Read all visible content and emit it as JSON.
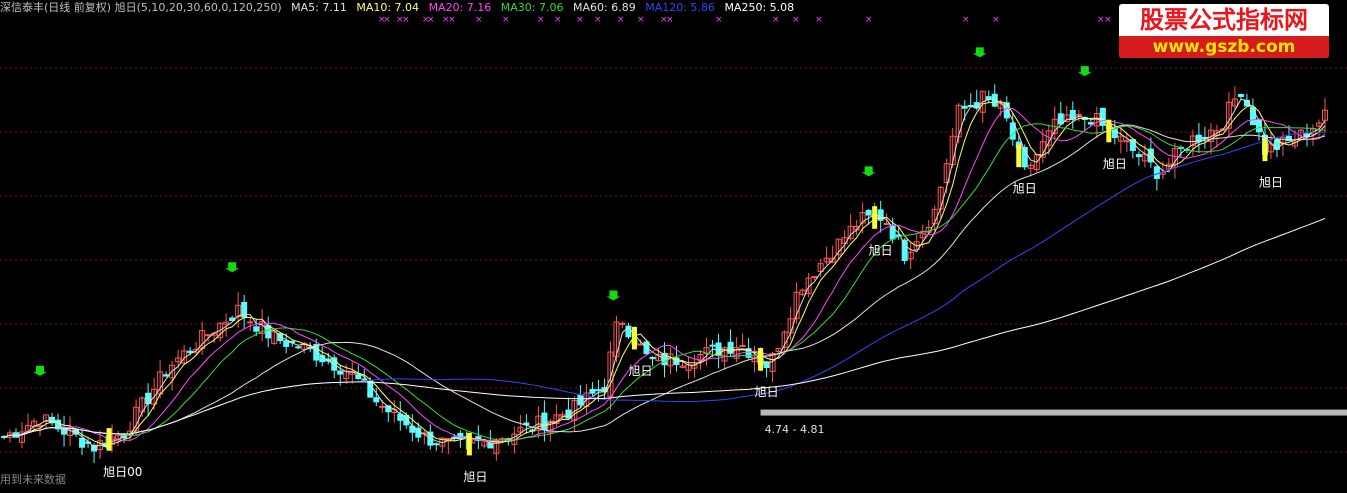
{
  "header": {
    "name": "深信泰丰(日线 前复权) 旭日(5,10,20,30,60,0,120,250)",
    "ma": [
      {
        "label": "MA5: 7.11",
        "color": "#e0e0e0"
      },
      {
        "label": "MA10: 7.04",
        "color": "#ffff66"
      },
      {
        "label": "MA20: 7.16",
        "color": "#ff44ff"
      },
      {
        "label": "MA30: 7.06",
        "color": "#33dd33"
      },
      {
        "label": "MA60: 6.89",
        "color": "#e0e0e0"
      },
      {
        "label": "MA120: 5.86",
        "color": "#3344ff"
      },
      {
        "label": "MA250: 5.08",
        "color": "#ffffff"
      }
    ]
  },
  "watermark": {
    "title": "股票公式指标网",
    "url": "www.gszb.com"
  },
  "footer_note": "用到未来数据",
  "colors": {
    "up": "#ff5555",
    "down": "#54ffff",
    "signal": "#ffff33",
    "arrow": "#11dd11",
    "grid": "#7a1515"
  },
  "chart_data": {
    "type": "candlestick",
    "n": 400,
    "ylim": [
      4.2,
      9.0
    ],
    "price_zone": {
      "label": "4.74 - 4.81",
      "low": 4.74,
      "high": 4.81
    },
    "signal_label": "旭日",
    "signal_days": [
      35,
      155,
      210,
      252,
      290,
      338,
      368,
      420
    ],
    "signal_texts": [
      {
        "day": 35,
        "text": "旭日00"
      },
      {
        "day": 155,
        "text": "旭日"
      },
      {
        "day": 210,
        "text": "旭日"
      },
      {
        "day": 252,
        "text": "旭日"
      },
      {
        "day": 290,
        "text": "旭日"
      },
      {
        "day": 338,
        "text": "旭日"
      },
      {
        "day": 368,
        "text": "旭日"
      },
      {
        "day": 420,
        "text": "旭日"
      }
    ],
    "peak_arrows": [
      12,
      76,
      203,
      288,
      325,
      360,
      410
    ],
    "close_path": [
      [
        0,
        4.55
      ],
      [
        12,
        4.75
      ],
      [
        20,
        4.62
      ],
      [
        30,
        4.45
      ],
      [
        40,
        4.6
      ],
      [
        55,
        5.3
      ],
      [
        70,
        5.7
      ],
      [
        78,
        5.9
      ],
      [
        90,
        5.6
      ],
      [
        100,
        5.5
      ],
      [
        115,
        5.25
      ],
      [
        125,
        4.9
      ],
      [
        140,
        4.55
      ],
      [
        150,
        4.45
      ],
      [
        160,
        4.5
      ],
      [
        175,
        4.65
      ],
      [
        190,
        4.85
      ],
      [
        200,
        5.1
      ],
      [
        205,
        5.85
      ],
      [
        215,
        5.35
      ],
      [
        230,
        5.4
      ],
      [
        245,
        5.55
      ],
      [
        255,
        5.3
      ],
      [
        265,
        6.15
      ],
      [
        275,
        6.5
      ],
      [
        285,
        6.85
      ],
      [
        293,
        6.9
      ],
      [
        300,
        6.5
      ],
      [
        310,
        6.95
      ],
      [
        318,
        8.0
      ],
      [
        326,
        8.15
      ],
      [
        333,
        8.0
      ],
      [
        340,
        7.35
      ],
      [
        350,
        7.85
      ],
      [
        362,
        7.95
      ],
      [
        372,
        7.7
      ],
      [
        385,
        7.35
      ],
      [
        395,
        7.7
      ],
      [
        405,
        7.85
      ],
      [
        412,
        8.25
      ],
      [
        420,
        7.6
      ],
      [
        430,
        7.7
      ],
      [
        440,
        7.95
      ]
    ],
    "x_max": 440
  }
}
